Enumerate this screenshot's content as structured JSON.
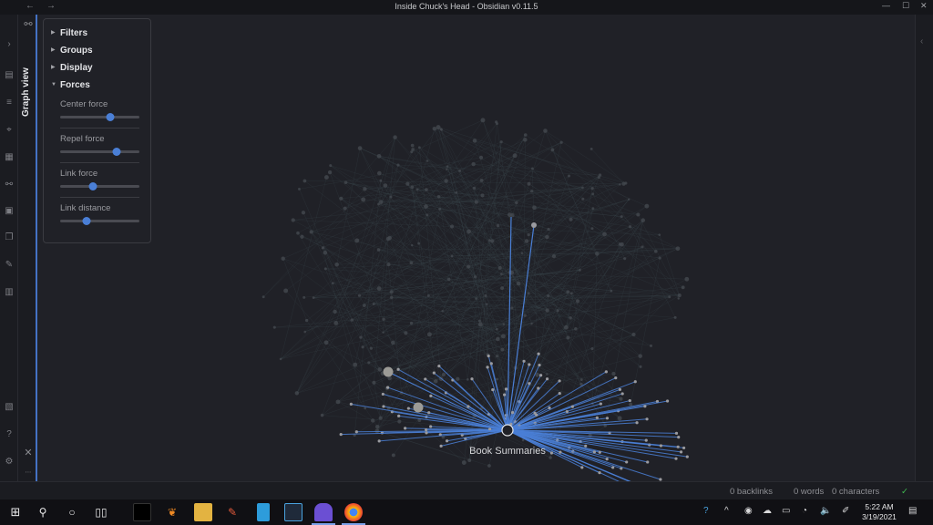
{
  "window": {
    "title": "Inside Chuck's Head - Obsidian v0.11.5",
    "back_icon": "arrow-left-icon",
    "forward_icon": "arrow-right-icon"
  },
  "view_tab": {
    "label": "Graph view"
  },
  "graph_panel": {
    "sections": [
      {
        "label": "Filters",
        "expanded": false
      },
      {
        "label": "Groups",
        "expanded": false
      },
      {
        "label": "Display",
        "expanded": false
      },
      {
        "label": "Forces",
        "expanded": true
      }
    ],
    "forces": [
      {
        "label": "Center force",
        "value": 0.63
      },
      {
        "label": "Repel force",
        "value": 0.71
      },
      {
        "label": "Link force",
        "value": 0.41
      },
      {
        "label": "Link distance",
        "value": 0.33
      }
    ]
  },
  "graph": {
    "focused_node_label": "Book Summaries",
    "accent": "#4a7fd6"
  },
  "status": {
    "backlinks": "0 backlinks",
    "words": "0 words",
    "characters": "0 characters"
  },
  "taskbar": {
    "time": "5:22 AM",
    "date": "3/19/2021"
  }
}
